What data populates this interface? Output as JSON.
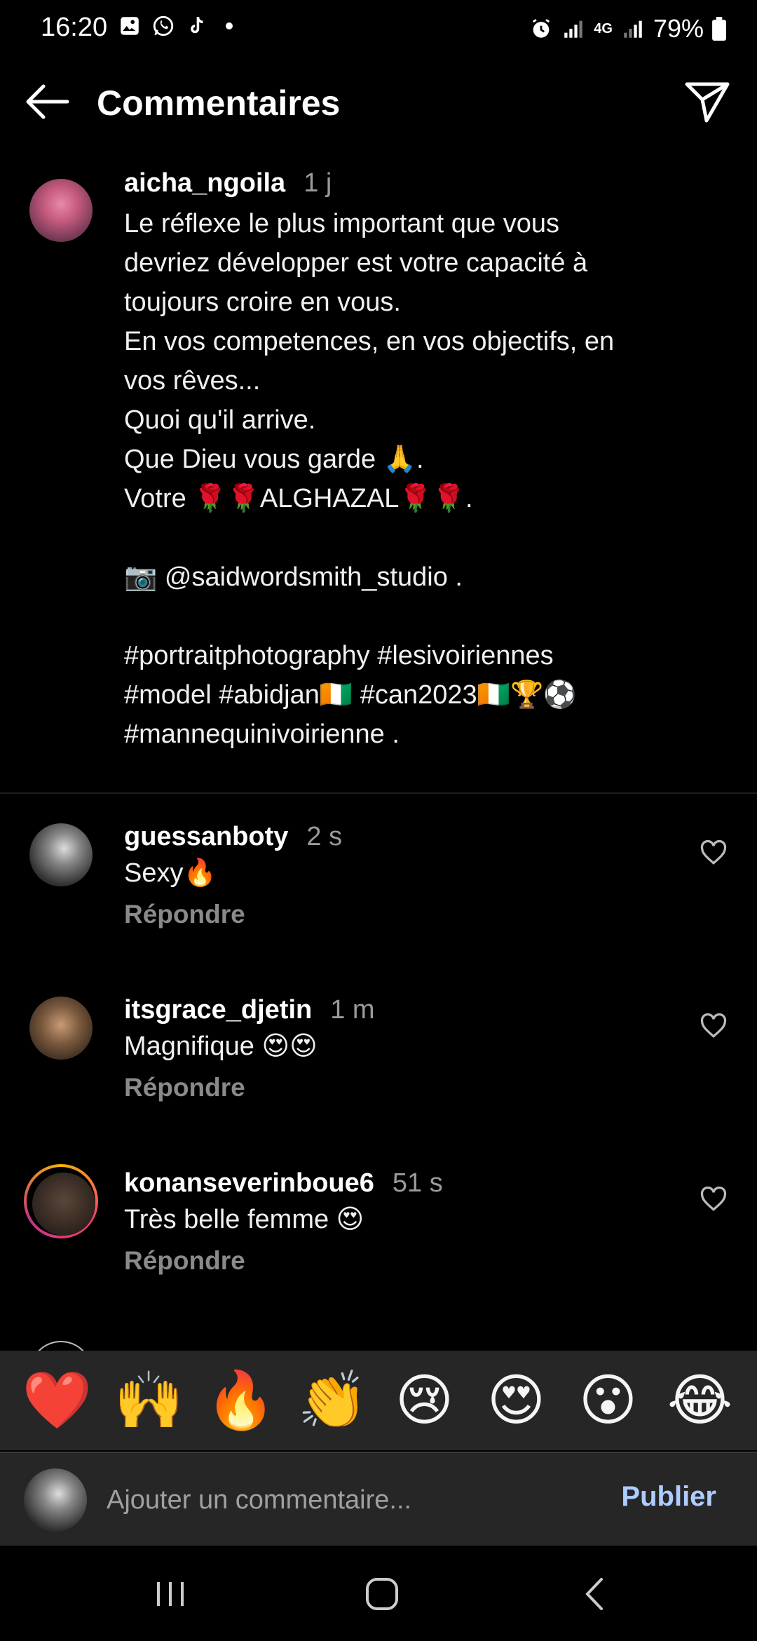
{
  "status_bar": {
    "time": "16:20",
    "network": "4G",
    "battery": "79%",
    "left_icons": [
      "gallery-icon",
      "whatsapp-icon",
      "tiktok-icon",
      "dot-icon"
    ],
    "right_icons": [
      "alarm-icon",
      "signal-icon",
      "signal-icon",
      "battery-icon"
    ]
  },
  "header": {
    "title": "Commentaires"
  },
  "caption": {
    "username": "aicha_ngoila",
    "time": "1 j",
    "text": "Le réflexe le plus important que vous\ndevriez développer est votre capacité à\ntoujours croire en vous.\nEn vos competences, en vos objectifs, en\nvos rêves...\nQuoi qu'il arrive.\nQue Dieu vous garde 🙏.\nVotre 🌹🌹ALGHAZAL🌹🌹.\n\n📷 @saidwordsmith_studio .\n\n#portraitphotography #lesivoiriennes\n#model #abidjan🇨🇮 #can2023🇨🇮🏆⚽\n#mannequinivoirienne ."
  },
  "comments": [
    {
      "username": "guessanboty",
      "time": "2 s",
      "text": "Sexy🔥",
      "reply": "Répondre"
    },
    {
      "username": "itsgrace_djetin",
      "time": "1 m",
      "text": "Magnifique 😍😍",
      "reply": "Répondre"
    },
    {
      "username": "konanseverinboue6",
      "time": "51 s",
      "text": "Très belle femme 😍",
      "reply": "Répondre"
    }
  ],
  "emoji_bar": [
    "❤️",
    "🙌",
    "🔥",
    "👏",
    "😢",
    "😍",
    "😮",
    "😂"
  ],
  "input": {
    "placeholder": "Ajouter un commentaire...",
    "publish_label": "Publier"
  },
  "colors": {
    "background": "#000000",
    "panel": "#262626",
    "muted_text": "#8a8a8a",
    "publish": "#aeccff"
  }
}
